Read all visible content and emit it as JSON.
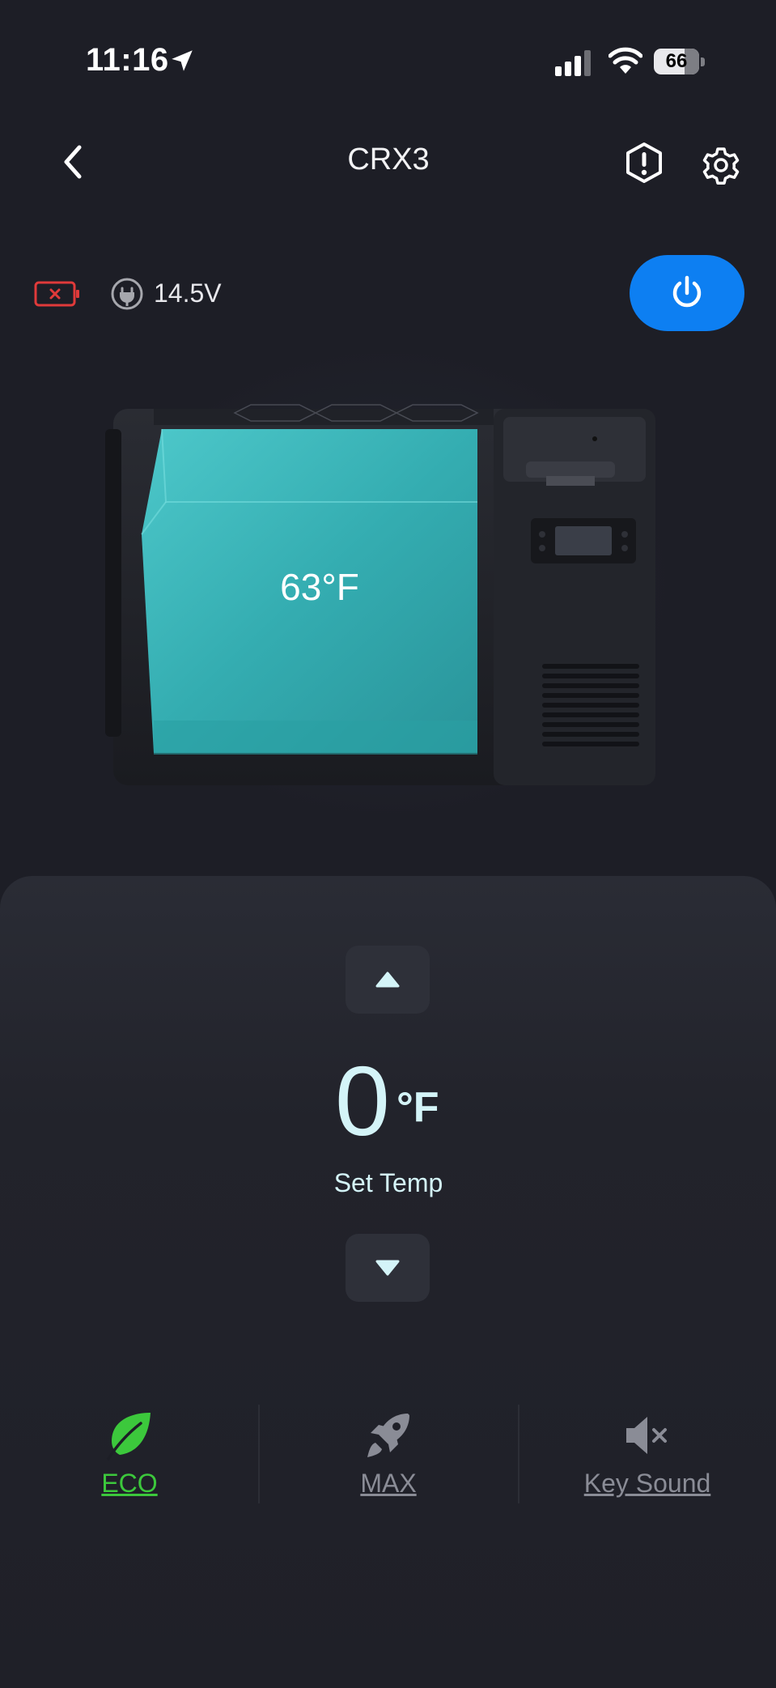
{
  "status_bar": {
    "time": "11:16",
    "battery_level": "66",
    "icons": [
      "location-arrow-icon",
      "cellular-signal-icon",
      "wifi-icon",
      "battery-icon"
    ]
  },
  "header": {
    "title": "CRX3",
    "icons": [
      "back-chevron-icon",
      "alert-hexagon-icon",
      "gear-icon"
    ]
  },
  "device_status": {
    "voltage": "14.5V",
    "icons": [
      "battery-warning-icon",
      "plug-icon",
      "power-icon"
    ]
  },
  "fridge": {
    "compartment_temp": "63°F"
  },
  "set_temp": {
    "value": "0",
    "unit": "°F",
    "label": "Set Temp",
    "icons": [
      "triangle-up-icon",
      "triangle-down-icon"
    ]
  },
  "modes": [
    {
      "label": "ECO",
      "icon": "leaf-icon",
      "active": true
    },
    {
      "label": "MAX",
      "icon": "rocket-icon",
      "active": false
    },
    {
      "label": "Key Sound",
      "icon": "speaker-mute-icon",
      "active": false
    }
  ],
  "colors": {
    "background": "#1d1e26",
    "accent_blue": "#0d7ff2",
    "eco_green": "#3cc83c",
    "inactive_gray": "#8a8c96",
    "warning_red": "#e03a3a",
    "temp_cyan": "#d4f4f8",
    "compartment_teal": "#3fbcc0"
  }
}
